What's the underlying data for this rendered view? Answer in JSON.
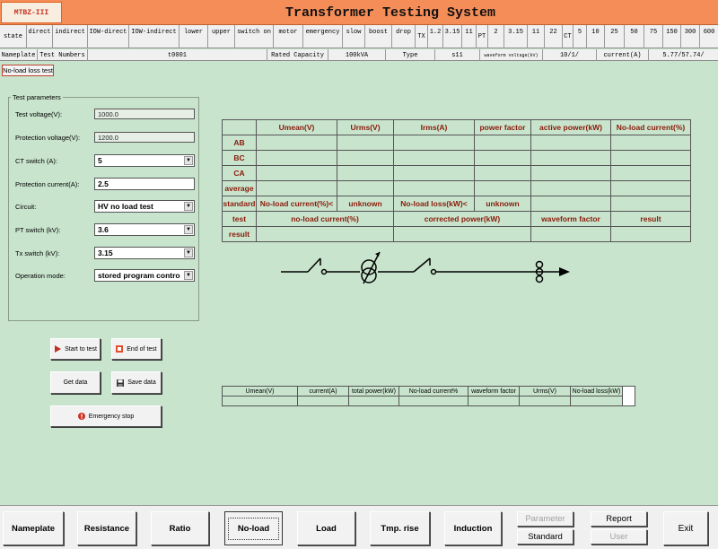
{
  "app": {
    "logo": "MTBZ-III",
    "title": "Transformer Testing System"
  },
  "state_row": {
    "label": "state",
    "items": [
      "direct",
      "indirect",
      "IOW-direct",
      "IOW-indirect",
      "lower",
      "upper",
      "switch on",
      "motor",
      "emergency",
      "slow",
      "boost",
      "drop"
    ],
    "tx_label": "TX",
    "tx_values": [
      "1.2",
      "3.15",
      "11"
    ],
    "pt_label": "PT",
    "pt_values": [
      "2",
      "3.15",
      "11",
      "22"
    ],
    "ct_label": "CT",
    "ct_values": [
      "5",
      "10",
      "25",
      "50",
      "75",
      "150",
      "300",
      "600"
    ]
  },
  "nameplate_row": {
    "label": "Nameplate",
    "test_numbers_label": "Test Numbers",
    "test_number": "t0001",
    "rated_capacity_label": "Rated Capacity",
    "rated_capacity": "100kVA",
    "type_label": "Type",
    "type_value": "s11",
    "waveform_label": "waveform voltage(kV)",
    "voltage": "10/1/",
    "current_label": "current(A)",
    "current_value": "5.77/57.74/"
  },
  "page_label": "No-load loss test",
  "params": {
    "title": "Test parameters",
    "test_voltage_label": "Test voltage(V):",
    "test_voltage": "1000.0",
    "protection_voltage_label": "Protection voltage(V):",
    "protection_voltage": "1200.0",
    "ct_switch_label": "CT switch (A):",
    "ct_switch": "5",
    "protection_current_label": "Protection current(A):",
    "protection_current": "2.5",
    "circuit_label": "Circuit:",
    "circuit": "HV no load test",
    "pt_switch_label": "PT switch (kV):",
    "pt_switch": "3.6",
    "tx_switch_label": "Tx switch (kV):",
    "tx_switch": "3.15",
    "operation_mode_label": "Operation mode:",
    "operation_mode": "stored program contro"
  },
  "buttons": {
    "start": "Start to test",
    "end": "End of test",
    "get_data": "Get data",
    "save_data": "Save data",
    "emergency": "Emergency stop"
  },
  "main_table": {
    "headers": [
      "Umean(V)",
      "Urms(V)",
      "Irms(A)",
      "power factor",
      "active power(kW)",
      "No-load current(%)"
    ],
    "rows": [
      "AB",
      "BC",
      "CA",
      "average"
    ],
    "standard_label": "standard",
    "std_noload_label": "No-load current(%)<",
    "std_noload_value": "unknown",
    "std_loss_label": "No-load loss(kW)<",
    "std_loss_value": "unknown",
    "test_label": "test",
    "test_headers": [
      "no-load current(%)",
      "corrected power(kW)",
      "waveform factor",
      "result"
    ],
    "result_label": "result"
  },
  "small_table": {
    "headers": [
      "Umean(V)",
      "current(A)",
      "total power(kW)",
      "No-load current%",
      "waveform factor",
      "Urms(V)",
      "No-load loss(kW)"
    ]
  },
  "nav": {
    "nameplate": "Nameplate",
    "resistance": "Resistance",
    "ratio": "Ratio",
    "noload": "No-load",
    "load": "Load",
    "tmp_rise": "Tmp. rise",
    "induction": "Induction",
    "parameter": "Parameter",
    "standard": "Standard",
    "report": "Report",
    "user": "User",
    "exit": "Exit"
  },
  "colors": {
    "background": "#c8e4cc",
    "titlebar": "#f58d58",
    "table_text": "#8a1a0a"
  }
}
